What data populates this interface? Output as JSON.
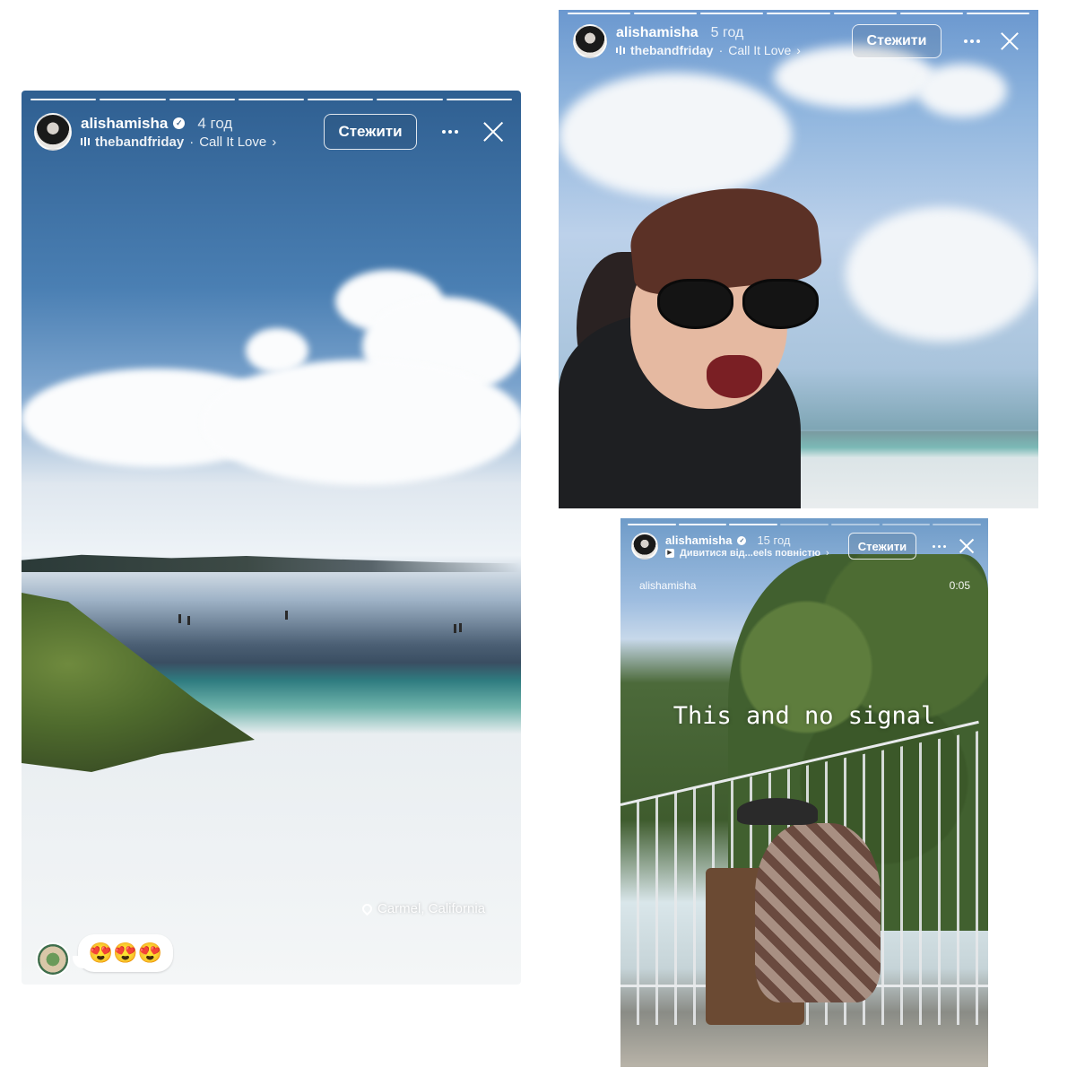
{
  "stories": [
    {
      "username": "alishamisha",
      "time": "4 год",
      "music_artist": "thebandfriday",
      "music_track": "Call It Love",
      "follow_label": "Стежити",
      "location": "Carmel, California",
      "reply_emojis": "😍😍😍",
      "progress": {
        "segments": 7,
        "current": 7
      }
    },
    {
      "username": "alishamisha",
      "time": "5 год",
      "music_artist": "thebandfriday",
      "music_track": "Call It Love",
      "follow_label": "Стежити",
      "progress": {
        "segments": 7,
        "current": 7
      }
    },
    {
      "username": "alishamisha",
      "time": "15 год",
      "reels_link": "Дивитися від...eels повністю",
      "follow_label": "Стежити",
      "reel_author": "alishamisha",
      "reel_duration": "0:05",
      "caption": "This and no signal",
      "progress": {
        "segments": 7,
        "current": 3
      }
    }
  ]
}
